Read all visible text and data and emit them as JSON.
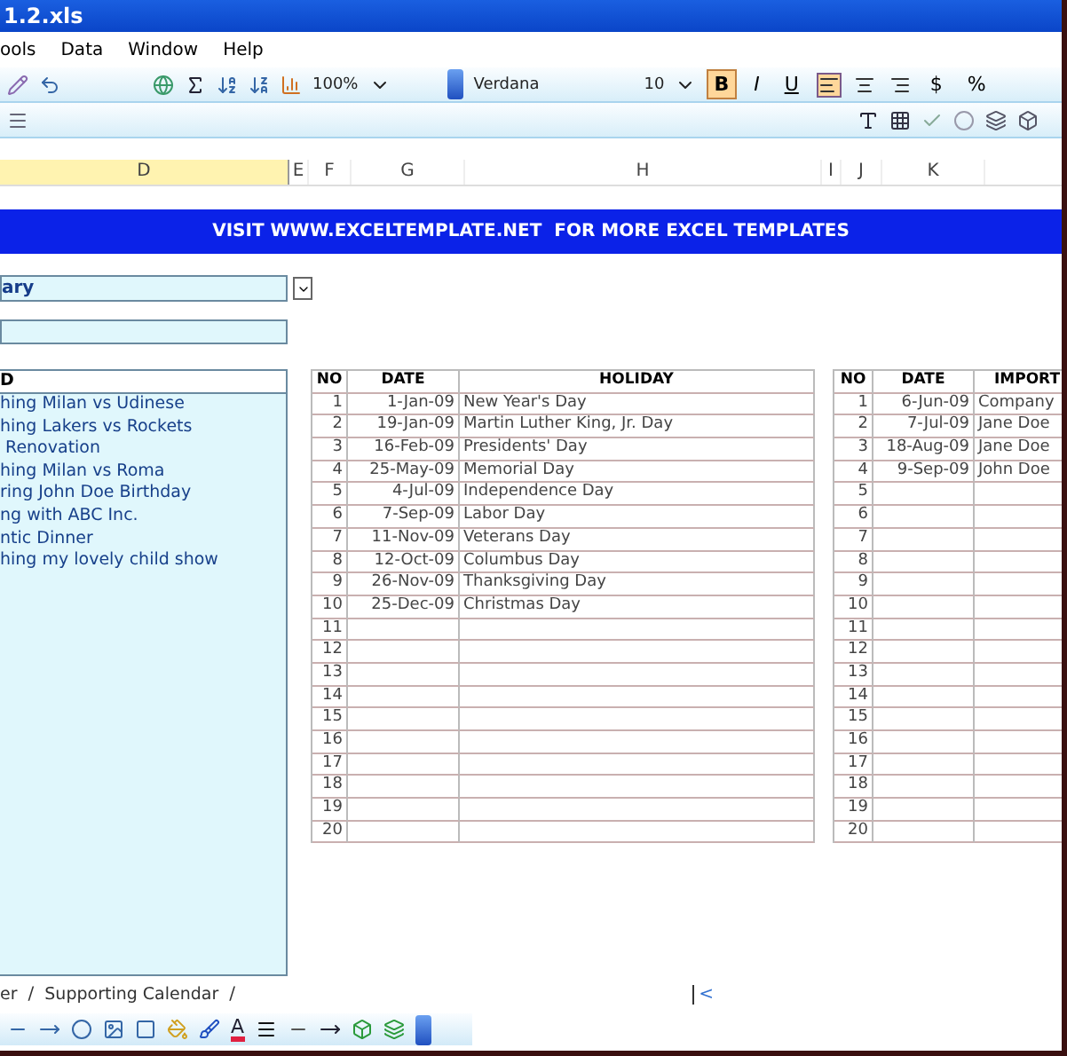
{
  "window": {
    "title": "1.2.xls"
  },
  "menu": [
    "ools",
    "Data",
    "Window",
    "Help"
  ],
  "toolbar": {
    "zoom": "100%",
    "font": "Verdana",
    "size": "10",
    "format_buttons": [
      {
        "label": "B",
        "selected": true
      },
      {
        "label": "I",
        "selected": false
      },
      {
        "label": "U",
        "selected": false
      }
    ],
    "align_buttons": [
      {
        "selected": true
      },
      {
        "selected": false
      },
      {
        "selected": false
      }
    ],
    "currency": "$",
    "percent": "%"
  },
  "columns": [
    {
      "label": "D",
      "selected": true
    },
    {
      "label": "E",
      "selected": false
    },
    {
      "label": "F",
      "selected": false
    },
    {
      "label": "G",
      "selected": false
    },
    {
      "label": "H",
      "selected": false
    },
    {
      "label": "I",
      "selected": false
    },
    {
      "label": "J",
      "selected": false
    },
    {
      "label": "K",
      "selected": false
    }
  ],
  "banner": "VISIT WWW.EXCELTEMPLATE.NET  FOR MORE EXCEL TEMPLATES",
  "dropdown": {
    "value": "ary"
  },
  "events": {
    "header": "D",
    "items": [
      "hing Milan vs Udinese",
      "hing Lakers vs Rockets",
      " Renovation",
      "hing Milan vs Roma",
      "ring John Doe Birthday",
      "ng with ABC Inc.",
      "ntic Dinner",
      "hing my lovely child show"
    ]
  },
  "holidays": {
    "columns": [
      "NO",
      "DATE",
      "HOLIDAY"
    ],
    "rows": [
      {
        "no": "1",
        "date": "1-Jan-09",
        "name": "New Year's Day"
      },
      {
        "no": "2",
        "date": "19-Jan-09",
        "name": "Martin Luther King, Jr. Day"
      },
      {
        "no": "3",
        "date": "16-Feb-09",
        "name": "Presidents' Day"
      },
      {
        "no": "4",
        "date": "25-May-09",
        "name": "Memorial Day"
      },
      {
        "no": "5",
        "date": "4-Jul-09",
        "name": "Independence Day"
      },
      {
        "no": "6",
        "date": "7-Sep-09",
        "name": "Labor Day"
      },
      {
        "no": "7",
        "date": "11-Nov-09",
        "name": "Veterans Day"
      },
      {
        "no": "8",
        "date": "12-Oct-09",
        "name": "Columbus Day"
      },
      {
        "no": "9",
        "date": "26-Nov-09",
        "name": "Thanksgiving Day"
      },
      {
        "no": "10",
        "date": "25-Dec-09",
        "name": "Christmas Day"
      },
      {
        "no": "11"
      },
      {
        "no": "12"
      },
      {
        "no": "13"
      },
      {
        "no": "14"
      },
      {
        "no": "15"
      },
      {
        "no": "16"
      },
      {
        "no": "17"
      },
      {
        "no": "18"
      },
      {
        "no": "19"
      },
      {
        "no": "20"
      }
    ]
  },
  "important": {
    "columns": [
      "NO",
      "DATE",
      "IMPORT"
    ],
    "rows": [
      {
        "no": "1",
        "date": "6-Jun-09",
        "name": "Company"
      },
      {
        "no": "2",
        "date": "7-Jul-09",
        "name": "Jane Doe"
      },
      {
        "no": "3",
        "date": "18-Aug-09",
        "name": "Jane Doe"
      },
      {
        "no": "4",
        "date": "9-Sep-09",
        "name": "John Doe"
      },
      {
        "no": "5"
      },
      {
        "no": "6"
      },
      {
        "no": "7"
      },
      {
        "no": "8"
      },
      {
        "no": "9"
      },
      {
        "no": "10"
      },
      {
        "no": "11"
      },
      {
        "no": "12"
      },
      {
        "no": "13"
      },
      {
        "no": "14"
      },
      {
        "no": "15"
      },
      {
        "no": "16"
      },
      {
        "no": "17"
      },
      {
        "no": "18"
      },
      {
        "no": "19"
      },
      {
        "no": "20"
      }
    ]
  },
  "sheet_tabs": [
    {
      "label": "er",
      "selected": false
    },
    {
      "label": "Supporting Calendar",
      "selected": false
    }
  ],
  "sheet_separators": [
    "/",
    "/"
  ],
  "scroll_glyph": "<",
  "font_color_glyph": "A"
}
